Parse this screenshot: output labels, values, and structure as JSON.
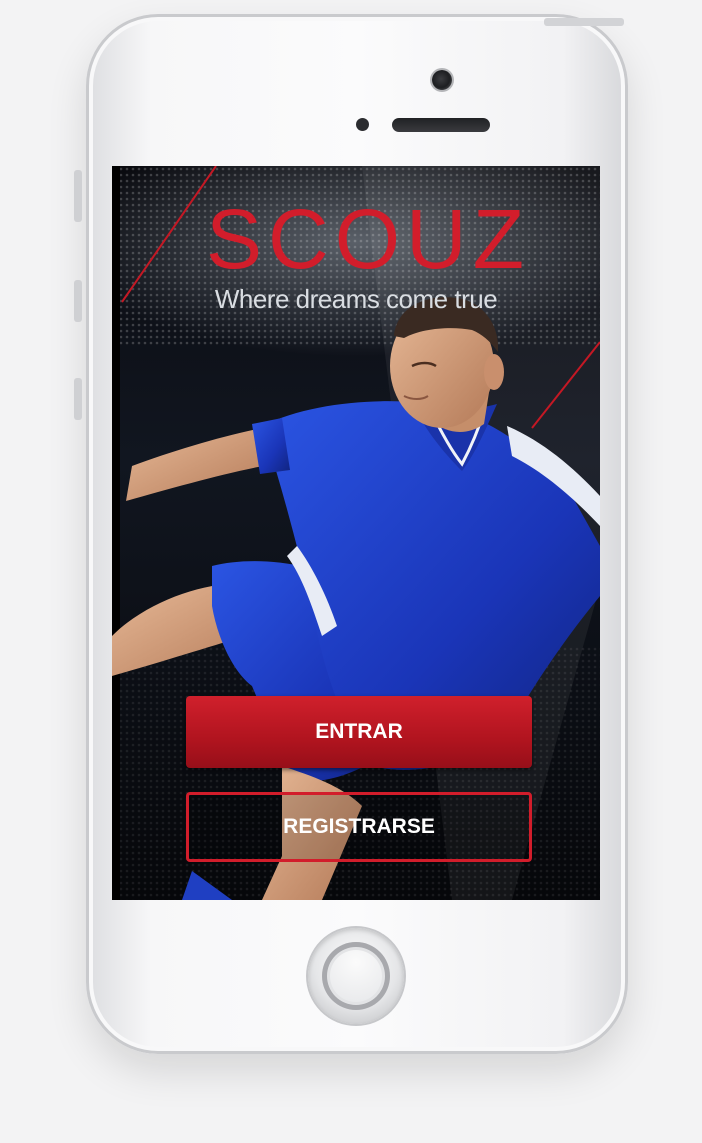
{
  "app": {
    "logo_text": "SCOUZ",
    "tagline": "Where dreams come true"
  },
  "actions": {
    "login_label": "ENTRAR",
    "register_label": "REGISTRARSE"
  },
  "colors": {
    "brand_red": "#d21d2b",
    "jersey_blue": "#1e3fc8",
    "background_dark": "#07090d"
  },
  "icons": [
    "front-camera-icon",
    "home-button-icon"
  ]
}
